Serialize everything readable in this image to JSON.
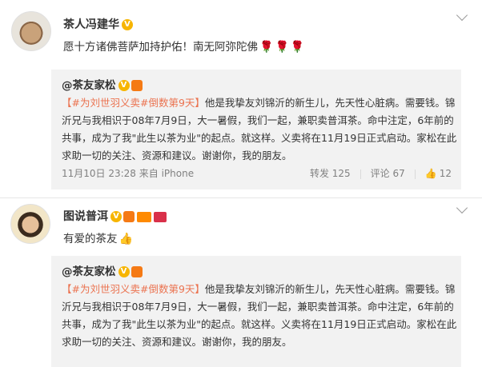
{
  "posts": [
    {
      "author": "茶人冯建华",
      "text": "愿十方诸佛菩萨加持护佑！南无阿弥陀佛",
      "emojis": [
        "🌹",
        "🌹",
        "🌹"
      ],
      "repost": {
        "author": "@茶友家松",
        "tag": "【#为刘世羽义卖#倒数第9天】",
        "body": "他是我挚友刘锦沂的新生儿，先天性心脏病。需要钱。锦沂兄与我相识于08年7月9日，大一暑假，我们一起，兼职卖普洱茶。命中注定，6年前的共事，成为了我\"此生以茶为业\"的起点。就这样。义卖将在11月19日正式启动。家松在此求助一切的关注、资源和建议。谢谢你，我的朋友。",
        "meta": "11月10日 23:28 来自 iPhone",
        "repost_label": "转发 125",
        "comment_label": "评论 67",
        "like_count": "12"
      }
    },
    {
      "author": "图说普洱",
      "text": "有爱的茶友",
      "emojis": [
        "👍"
      ],
      "repost": {
        "author": "@茶友家松",
        "tag": "【#为刘世羽义卖#倒数第9天】",
        "body": "他是我挚友刘锦沂的新生儿，先天性心脏病。需要钱。锦沂兄与我相识于08年7月9日，大一暑假，我们一起，兼职卖普洱茶。命中注定，6年前的共事，成为了我\"此生以茶为业\"的起点。就这样。义卖将在11月19日正式启动。家松在此求助一切的关注、资源和建议。谢谢你，我的朋友。"
      }
    }
  ],
  "icons": {
    "verified": "V",
    "thumb": "👍"
  },
  "colors": {
    "tag": "#eb7350",
    "repost_bg": "#f2f2f2",
    "meta": "#808080"
  }
}
